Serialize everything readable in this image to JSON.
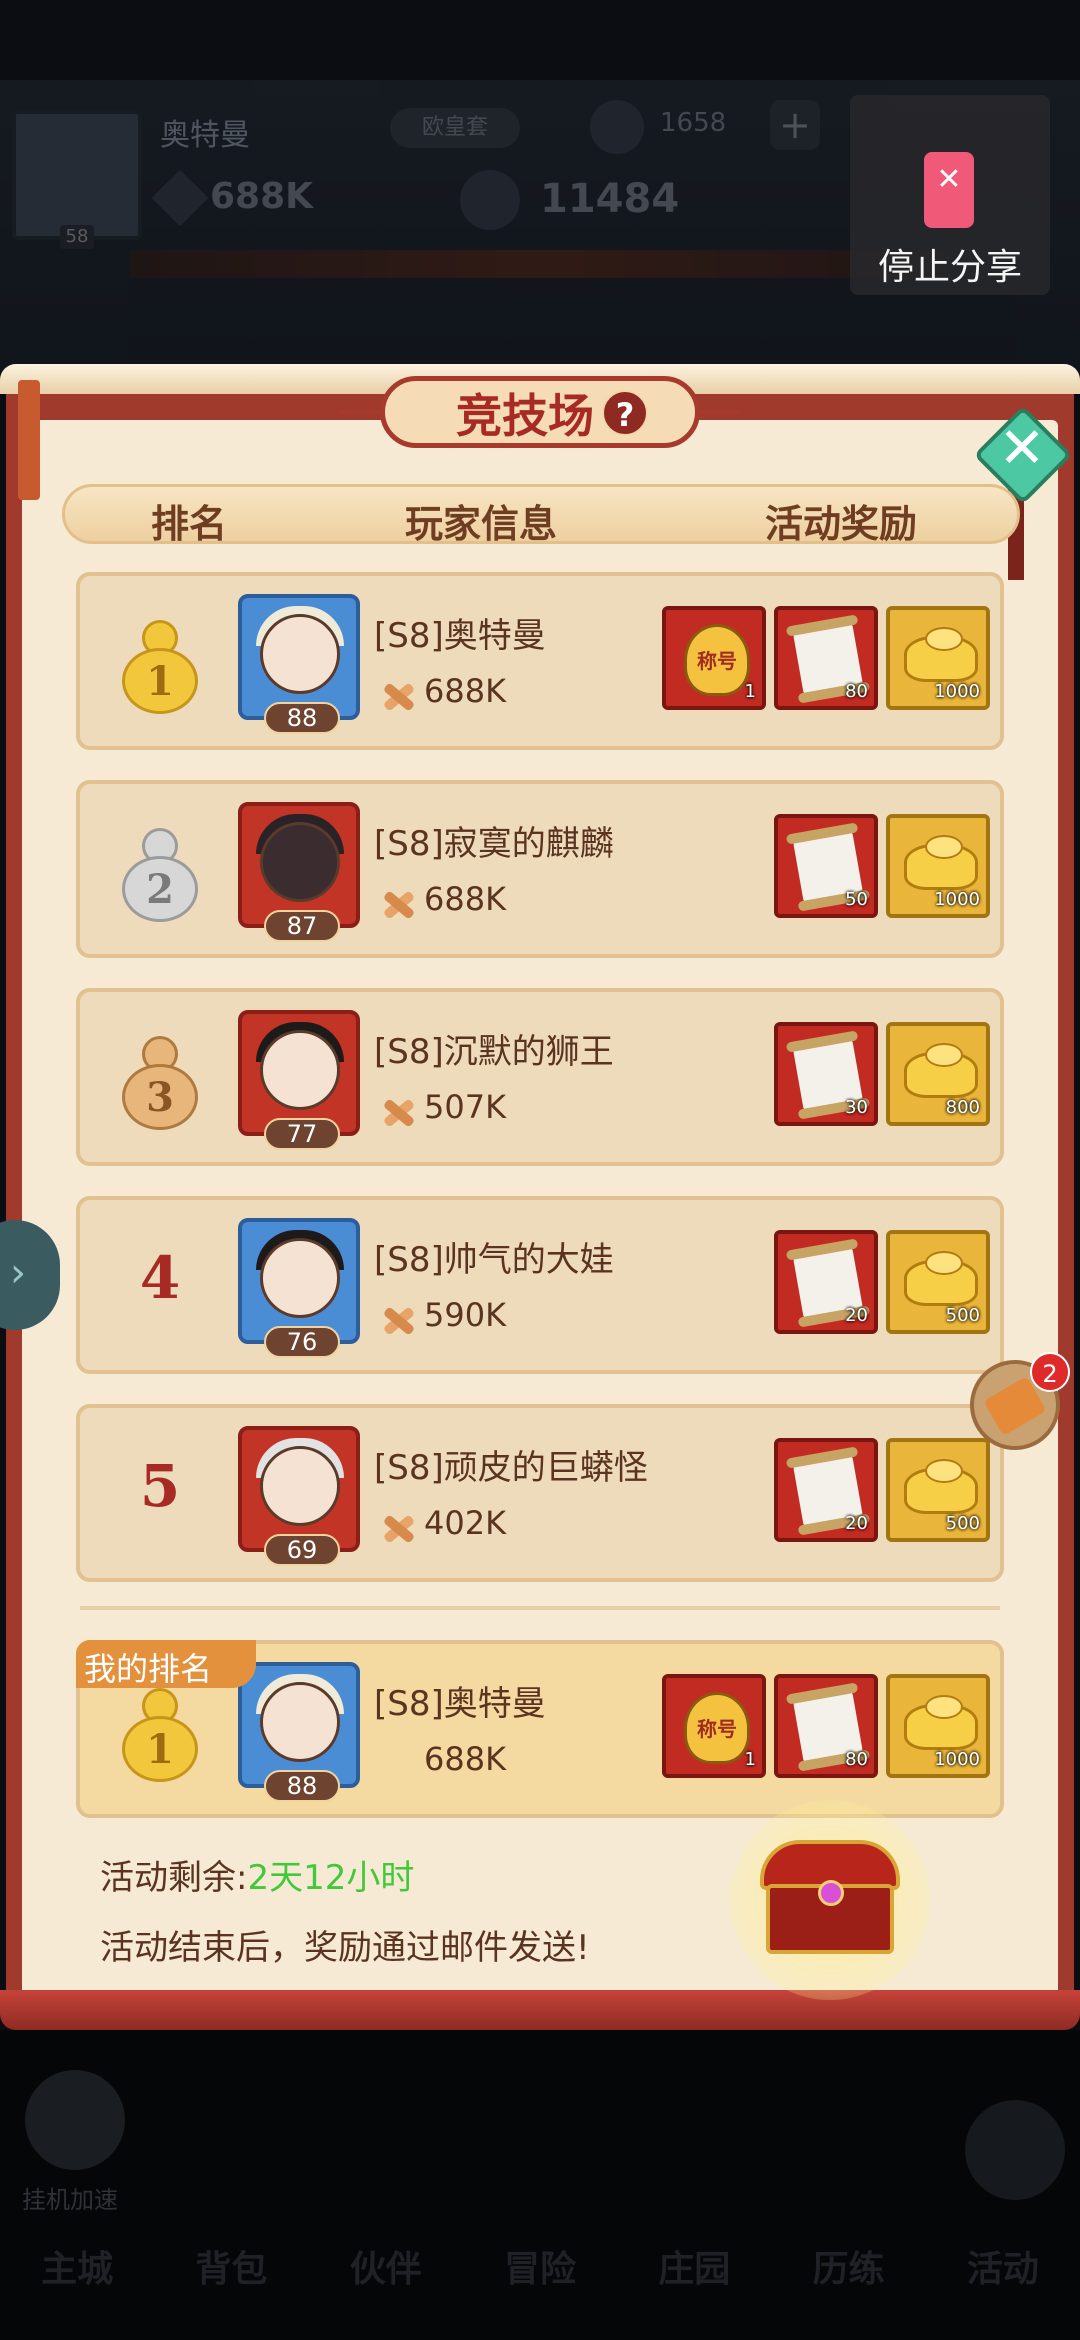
{
  "background_hud": {
    "player_name": "奥特曼",
    "avatar_level": "58",
    "server_pill": "欧皇套",
    "coins": "1658",
    "plus_label": "+",
    "power": "688K",
    "gold": "11484"
  },
  "share": {
    "label": "停止分享"
  },
  "dialog": {
    "title": "竞技场",
    "help_label": "?",
    "close_label": "✕",
    "headers": {
      "rank": "排名",
      "player_info": "玩家信息",
      "rewards": "活动奖励"
    }
  },
  "rankings": [
    {
      "rank": "1",
      "medal": "gold",
      "name": "[S8]奥特曼",
      "level": "88",
      "power": "688K",
      "frame": "blue",
      "rewards": [
        {
          "type": "title-badge",
          "label": "称号",
          "qty": "1"
        },
        {
          "type": "scroll",
          "qty": "80"
        },
        {
          "type": "ingot",
          "qty": "1000"
        }
      ]
    },
    {
      "rank": "2",
      "medal": "silver",
      "name": "[S8]寂寞的麒麟",
      "level": "87",
      "power": "688K",
      "frame": "red",
      "rewards": [
        {
          "type": "scroll",
          "qty": "50"
        },
        {
          "type": "ingot",
          "qty": "1000"
        }
      ]
    },
    {
      "rank": "3",
      "medal": "bronze",
      "name": "[S8]沉默的狮王",
      "level": "77",
      "power": "507K",
      "frame": "red",
      "rewards": [
        {
          "type": "scroll",
          "qty": "30"
        },
        {
          "type": "ingot",
          "qty": "800"
        }
      ]
    },
    {
      "rank": "4",
      "medal": "none",
      "name": "[S8]帅气的大娃",
      "level": "76",
      "power": "590K",
      "frame": "blue",
      "rewards": [
        {
          "type": "scroll",
          "qty": "20"
        },
        {
          "type": "ingot",
          "qty": "500"
        }
      ]
    },
    {
      "rank": "5",
      "medal": "none",
      "name": "[S8]顽皮的巨蟒怪",
      "level": "69",
      "power": "402K",
      "frame": "red",
      "rewards": [
        {
          "type": "scroll",
          "qty": "20"
        },
        {
          "type": "ingot",
          "qty": "500"
        }
      ]
    }
  ],
  "my_rank": {
    "tag": "我的排名",
    "rank": "1",
    "name": "[S8]奥特曼",
    "level": "88",
    "power": "688K",
    "rewards": [
      {
        "type": "title-badge",
        "label": "称号",
        "qty": "1"
      },
      {
        "type": "scroll",
        "qty": "80"
      },
      {
        "type": "ingot",
        "qty": "1000"
      }
    ]
  },
  "footer": {
    "remain_label": "活动剩余:",
    "remain_value": "2天12小时",
    "note": "活动结束后，奖励通过邮件发送!"
  },
  "side": {
    "quill_badge": "2"
  },
  "bottom_nav": {
    "boost_label": "挂机加速",
    "items": [
      "主城",
      "背包",
      "伙伴",
      "冒险",
      "庄园",
      "历练",
      "活动"
    ]
  },
  "colors": {
    "panel_red": "#a03a2c",
    "parchment": "#f6ead4",
    "remain_green": "#42c83a",
    "title_red": "#a72b24"
  }
}
